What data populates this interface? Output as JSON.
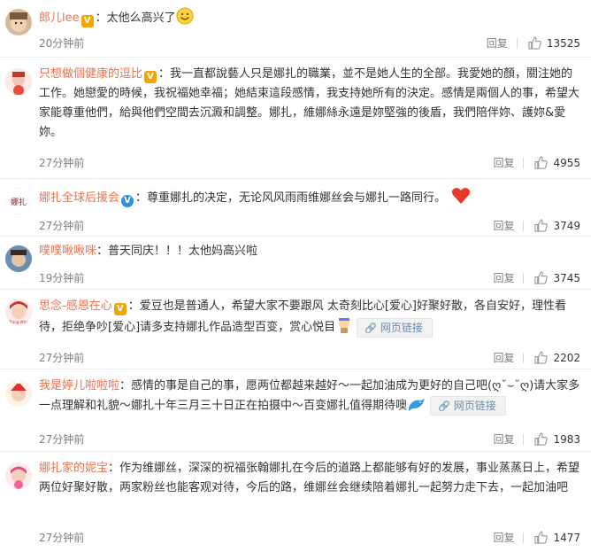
{
  "comments": [
    {
      "username": "郎儿lee",
      "badge": "gold",
      "separator": "：",
      "text": "太他么高兴了",
      "time": "20分钟前",
      "reply_label": "回复",
      "likes": "13525"
    },
    {
      "username": "只想做個健康的逗比",
      "badge": "gold",
      "separator": "：",
      "text": "我一直都說藝人只是娜扎的職業，並不是她人生的全部。我愛她的顏，關注她的工作。她戀愛的時候，我祝福她幸福；她結束這段感情，我支持她所有的決定。感情是兩個人的事，希望大家能尊重他們，給與他們空間去沉澱和調整。娜扎，維娜絲永遠是妳堅強的後盾，我們陪伴妳、護妳&愛妳。",
      "time": "27分钟前",
      "reply_label": "回复",
      "likes": "4955"
    },
    {
      "username": "娜扎全球后援会",
      "badge": "blue",
      "separator": "：",
      "text": "尊重娜扎的决定，无论风风雨雨维娜丝会与娜扎一路同行。",
      "time": "27分钟前",
      "reply_label": "回复",
      "likes": "3749"
    },
    {
      "username": "噗噗啾啾咪",
      "badge": "",
      "separator": "：",
      "text": "普天同庆！！！太他妈高兴啦",
      "time": "19分钟前",
      "reply_label": "回复",
      "likes": "3745"
    },
    {
      "username": "思念-感恩在心",
      "badge": "gold",
      "separator": "：",
      "text": "爱豆也是普通人，希望大家不要跟风 太奇刻比心[爱心]好聚好散，各自安好，理性看待，拒绝争吵[爱心]请多支持娜扎作品造型百变，赏心悦目",
      "link_label": "网页链接",
      "time": "27分钟前",
      "reply_label": "回复",
      "likes": "2202"
    },
    {
      "username": "我是婷儿啦啦啦",
      "badge": "",
      "separator": "：",
      "text": "感情的事是自己的事，愿两位都越来越好～一起加油成为更好的自己吧(ღ˘⌣˘ღ)请大家多一点理解和礼貌～娜扎十年三月三十日正在拍摄中～百变娜扎值得期待噢",
      "link_label": "网页链接",
      "time": "27分钟前",
      "reply_label": "回复",
      "likes": "1983"
    },
    {
      "username": "娜扎家的妮宝",
      "badge": "",
      "separator": "：",
      "text": "作为维娜丝，深深的祝福张翰娜扎在今后的道路上都能够有好的发展，事业蒸蒸日上，希望两位好聚好散，两家粉丝也能客观对待，今后的路，维娜丝会继续陪着娜扎一起努力走下去，一起加油吧",
      "time": "27分钟前",
      "reply_label": "回复",
      "likes": "1477"
    }
  ],
  "colors": {
    "username": "#eb7350",
    "meta": "#808080",
    "badge_gold": "#f7a300",
    "badge_blue": "#2c8fe0",
    "like_icon": "#a0a0a0"
  },
  "icons": [
    "thumbs-up-icon",
    "link-icon",
    "smiley-emoji-icon",
    "heart-emoji-icon",
    "vip-badge-icon"
  ]
}
